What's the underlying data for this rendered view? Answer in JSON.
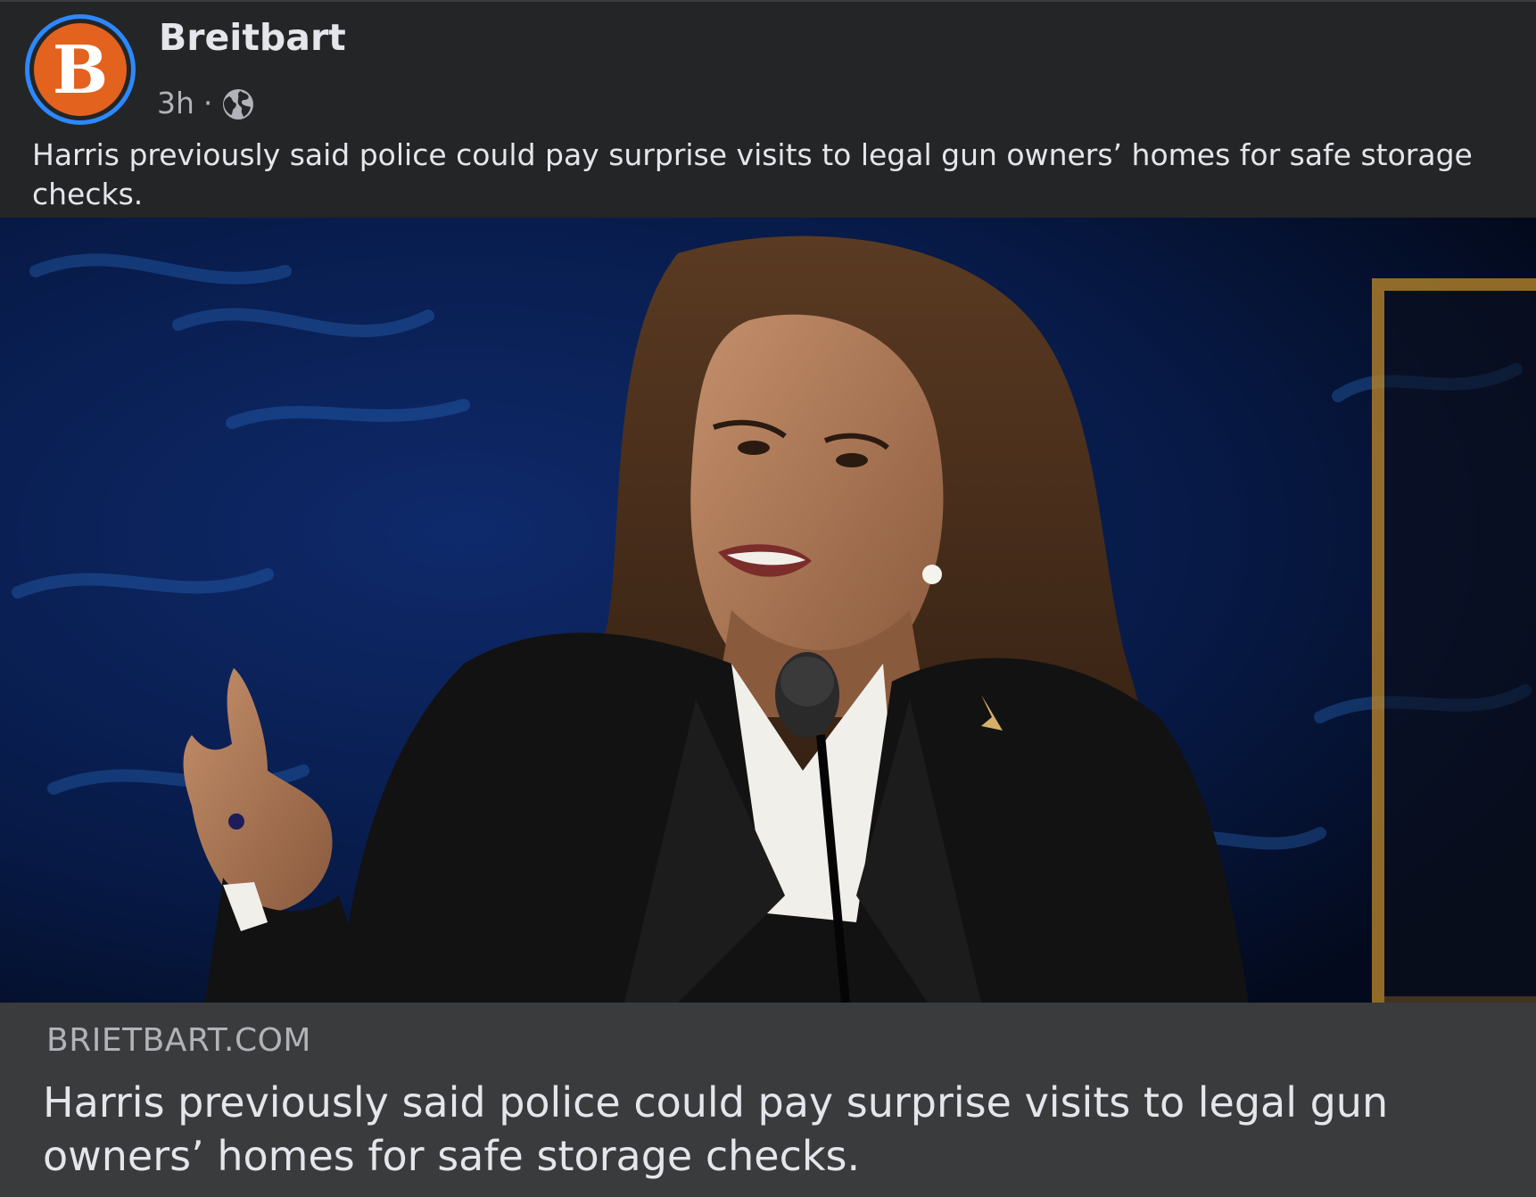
{
  "post": {
    "page_name": "Breitbart",
    "avatar_letter": "B",
    "time": "3h",
    "separator": "·",
    "privacy_icon": "globe-icon",
    "caption": "Harris previously said police could pay surprise visits to legal gun owners’ homes for safe storage checks."
  },
  "link_preview": {
    "domain": "BRIETBART.COM",
    "headline": "Harris previously said police could pay surprise visits to legal gun owners’ homes for safe storage checks."
  },
  "colors": {
    "background": "#242526",
    "link_box": "#3a3b3c",
    "avatar_ring": "#2d88ff",
    "avatar_fill": "#e3621e",
    "primary_text": "#e4e6eb",
    "secondary_text": "#b0b3b8"
  }
}
